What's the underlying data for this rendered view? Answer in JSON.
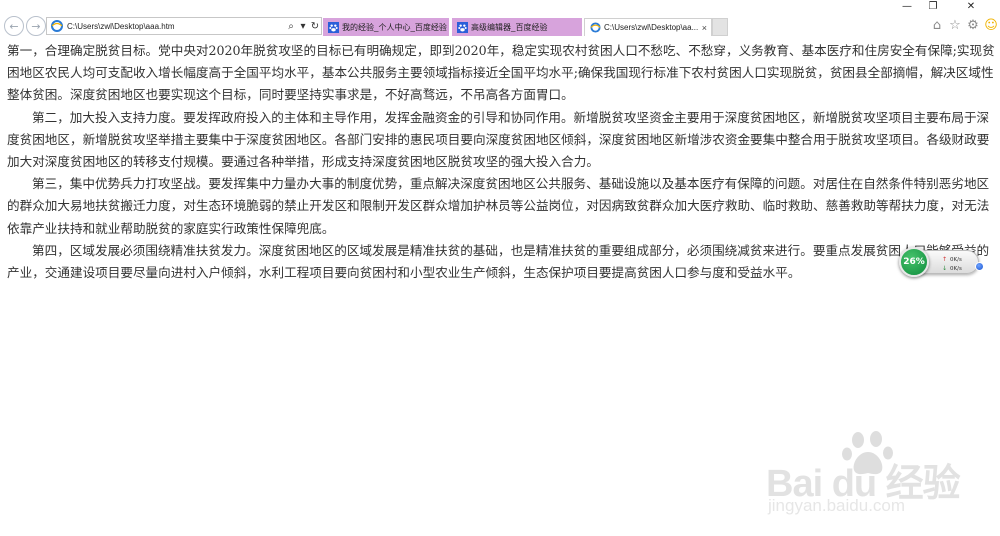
{
  "window": {
    "minimize_icon": "minimize-icon",
    "restore_icon": "restore-icon",
    "close_icon": "close-icon",
    "minimize_glyph": "—",
    "restore_glyph": "❐",
    "close_glyph": "✕"
  },
  "nav": {
    "back_icon": "back-arrow-icon",
    "forward_icon": "forward-arrow-icon",
    "back_glyph": "←",
    "forward_glyph": "→"
  },
  "address_bar": {
    "value": "C:\\Users\\zwl\\Desktop\\aaa.htm",
    "search_glyph": "⌕",
    "dropdown_glyph": "▾",
    "refresh_glyph": "↻"
  },
  "tabs": [
    {
      "label": "我的经验_个人中心_百度经验",
      "active": false,
      "icon": "baidu-paw-icon"
    },
    {
      "label": "高级编辑器_百度经验",
      "active": false,
      "icon": "baidu-paw-icon"
    },
    {
      "label": "C:\\Users\\zwl\\Desktop\\aa...",
      "active": true,
      "icon": "ie-page-icon",
      "close_glyph": "×"
    }
  ],
  "toolbar": {
    "home_glyph": "⌂",
    "favorites_glyph": "☆",
    "settings_glyph": "⚙",
    "feedback_glyph": "☺"
  },
  "content": {
    "paragraphs": [
      "第一，合理确定脱贫目标。党中央对2020年脱贫攻坚的目标已有明确规定，即到2020年，稳定实现农村贫困人口不愁吃、不愁穿，义务教育、基本医疗和住房安全有保障;实现贫困地区农民人均可支配收入增长幅度高于全国平均水平，基本公共服务主要领域指标接近全国平均水平;确保我国现行标准下农村贫困人口实现脱贫，贫困县全部摘帽，解决区域性整体贫困。深度贫困地区也要实现这个目标，同时要坚持实事求是，不好高骛远，不吊高各方面胃口。",
      "第二，加大投入支持力度。要发挥政府投入的主体和主导作用，发挥金融资金的引导和协同作用。新增脱贫攻坚资金主要用于深度贫困地区，新增脱贫攻坚项目主要布局于深度贫困地区，新增脱贫攻坚举措主要集中于深度贫困地区。各部门安排的惠民项目要向深度贫困地区倾斜，深度贫困地区新增涉农资金要集中整合用于脱贫攻坚项目。各级财政要加大对深度贫困地区的转移支付规模。要通过各种举措，形成支持深度贫困地区脱贫攻坚的强大投入合力。",
      "第三，集中优势兵力打攻坚战。要发挥集中力量办大事的制度优势，重点解决深度贫困地区公共服务、基础设施以及基本医疗有保障的问题。对居住在自然条件特别恶劣地区的群众加大易地扶贫搬迁力度，对生态环境脆弱的禁止开发区和限制开发区群众增加护林员等公益岗位，对因病致贫群众加大医疗救助、临时救助、慈善救助等帮扶力度，对无法依靠产业扶持和就业帮助脱贫的家庭实行政策性保障兜底。",
      "第四，区域发展必须围绕精准扶贫发力。深度贫困地区的区域发展是精准扶贫的基础，也是精准扶贫的重要组成部分，必须围绕减贫来进行。要重点发展贫困人口能够受益的产业，交通建设项目要尽量向进村入户倾斜，水利工程项目要向贫困村和小型农业生产倾斜，生态保护项目要提高贫困人口参与度和受益水平。"
    ]
  },
  "speed_widget": {
    "percent": "26%",
    "upload": "0K/s",
    "download": "0K/s",
    "up_glyph": "↑",
    "down_glyph": "↓"
  },
  "watermark": {
    "brand": "Bai du 经验",
    "url": "jingyan.baidu.com"
  },
  "colors": {
    "tab_inactive": "#d7a3dc",
    "text": "#333333",
    "widget_green": "#1f9e4c"
  }
}
